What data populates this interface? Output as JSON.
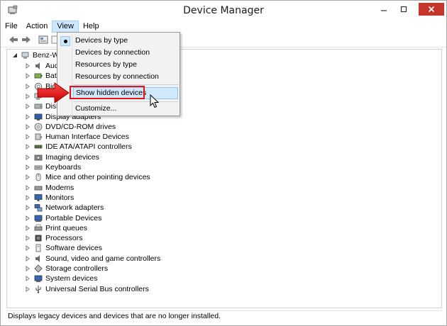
{
  "window": {
    "title": "Device Manager"
  },
  "menubar": {
    "items": [
      "File",
      "Action",
      "View",
      "Help"
    ]
  },
  "view_menu": {
    "items": [
      {
        "label": "Devices by type",
        "checked": true
      },
      {
        "label": "Devices by connection"
      },
      {
        "label": "Resources by type"
      },
      {
        "label": "Resources by connection"
      },
      {
        "label": "Show hidden devices",
        "highlighted": true
      },
      {
        "label": "Customize..."
      }
    ]
  },
  "tree": {
    "root_label": "Benz-W",
    "items": [
      {
        "label": "Aud",
        "icon": "speaker-icon"
      },
      {
        "label": "Batt",
        "icon": "battery-icon"
      },
      {
        "label": "Bio",
        "icon": "biometric-icon"
      },
      {
        "label": "",
        "icon": "computer-icon"
      },
      {
        "label": "Disk",
        "icon": "disk-icon"
      },
      {
        "label": "Display adapters",
        "icon": "display-icon"
      },
      {
        "label": "DVD/CD-ROM drives",
        "icon": "dvd-icon"
      },
      {
        "label": "Human Interface Devices",
        "icon": "hid-icon"
      },
      {
        "label": "IDE ATA/ATAPI controllers",
        "icon": "ide-icon"
      },
      {
        "label": "Imaging devices",
        "icon": "camera-icon"
      },
      {
        "label": "Keyboards",
        "icon": "keyboard-icon"
      },
      {
        "label": "Mice and other pointing devices",
        "icon": "mouse-icon"
      },
      {
        "label": "Modems",
        "icon": "modem-icon"
      },
      {
        "label": "Monitors",
        "icon": "monitor-icon"
      },
      {
        "label": "Network adapters",
        "icon": "network-icon"
      },
      {
        "label": "Portable Devices",
        "icon": "portable-icon"
      },
      {
        "label": "Print queues",
        "icon": "printer-icon"
      },
      {
        "label": "Processors",
        "icon": "cpu-icon"
      },
      {
        "label": "Software devices",
        "icon": "software-icon"
      },
      {
        "label": "Sound, video and game controllers",
        "icon": "speaker-icon"
      },
      {
        "label": "Storage controllers",
        "icon": "storage-icon"
      },
      {
        "label": "System devices",
        "icon": "system-icon"
      },
      {
        "label": "Universal Serial Bus controllers",
        "icon": "usb-icon"
      }
    ]
  },
  "statusbar": {
    "text": "Displays legacy devices and devices that are no longer installed."
  },
  "colors": {
    "highlight_red": "#e3121b",
    "close_button": "#c7362b",
    "menu_hover": "#d1e8fb"
  }
}
